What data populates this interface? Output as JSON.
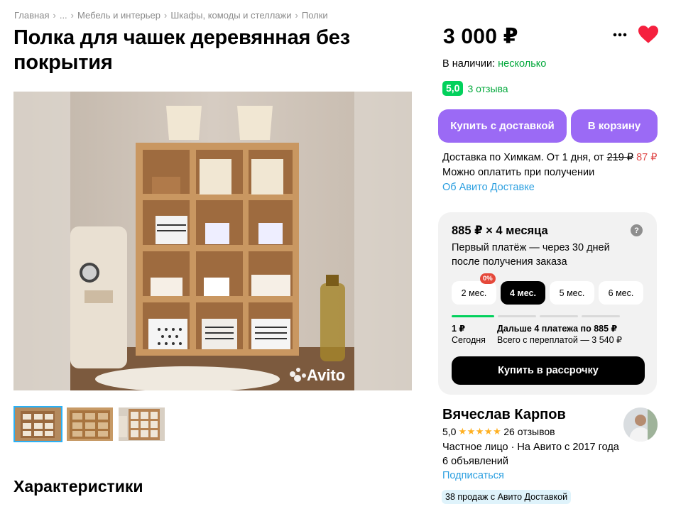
{
  "breadcrumb": [
    "Главная",
    "...",
    "Мебель и интерьер",
    "Шкафы, комоды и стеллажи",
    "Полки"
  ],
  "title": "Полка для чашек деревянная без покрытия",
  "price": "3 000 ₽",
  "availability": {
    "label": "В наличии:",
    "value": "несколько"
  },
  "rating": {
    "score": "5,0",
    "reviews_link": "3 отзыва"
  },
  "buttons": {
    "buy_delivery": "Купить с доставкой",
    "to_cart": "В корзину"
  },
  "delivery": {
    "text": "Доставка по Химкам. От 1 дня, от",
    "old_price": "219 ₽",
    "new_price": "87 ₽",
    "pay_on_receipt": "Можно оплатить при получении",
    "about_link": "Об Авито Доставке"
  },
  "installment": {
    "title": "885 ₽ × 4 месяца",
    "help": "?",
    "description": "Первый платёж — через 30 дней после получения заказа",
    "terms": [
      {
        "label": "2 мес.",
        "badge": "0%"
      },
      {
        "label": "4 мес.",
        "active": true
      },
      {
        "label": "5 мес."
      },
      {
        "label": "6 мес."
      }
    ],
    "first_amount": "1 ₽",
    "first_when": "Сегодня",
    "rest_title": "Дальше 4 платежа по 885 ₽",
    "rest_total": "Всего с переплатой — 3 540 ₽",
    "button": "Купить в рассрочку"
  },
  "seller": {
    "name": "Вячеслав Карпов",
    "score": "5,0",
    "stars": "★★★★★",
    "reviews": "26 отзывов",
    "type": "Частное лицо · На Авито с 2017 года",
    "ads": "6 объявлений",
    "subscribe": "Подписаться",
    "sales_badge": "38 продаж с Авито Доставкой"
  },
  "watermark": "Avito",
  "section_title": "Характеристики",
  "colors": {
    "accent_purple": "#9b6af5",
    "green": "#02d15c",
    "link_blue": "#2b9fe0",
    "heart_red": "#f5203e"
  }
}
